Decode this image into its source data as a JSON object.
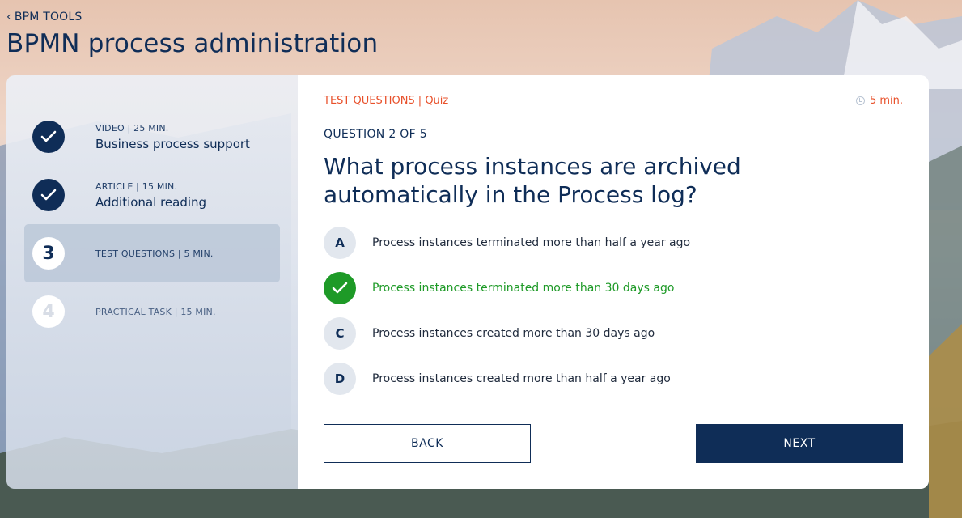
{
  "header": {
    "back_label": "BPM TOOLS",
    "title": "BPMN process administration"
  },
  "sidebar": {
    "steps": [
      {
        "state": "done",
        "meta": "VIDEO | 25 MIN.",
        "title": "Business process support"
      },
      {
        "state": "done",
        "meta": "ARTICLE | 15 MIN.",
        "title": "Additional reading"
      },
      {
        "state": "current",
        "number": "3",
        "meta": "TEST QUESTIONS | 5 MIN."
      },
      {
        "state": "todo",
        "number": "4",
        "meta": "PRACTICAL TASK | 15 MIN."
      }
    ]
  },
  "quiz": {
    "crumb": "TEST QUESTIONS | Quiz",
    "duration": "5 min.",
    "counter": "QUESTION 2 OF 5",
    "question": "What process instances are archived automatically in the Process log?",
    "answers": [
      {
        "letter": "A",
        "text": "Process instances terminated more than half a year ago",
        "correct": false
      },
      {
        "letter": "B",
        "text": "Process instances terminated more than 30 days ago",
        "correct": true
      },
      {
        "letter": "C",
        "text": "Process instances created more than 30 days ago",
        "correct": false
      },
      {
        "letter": "D",
        "text": "Process instances created more than half a year ago",
        "correct": false
      }
    ]
  },
  "buttons": {
    "back_label": "BACK",
    "next_label": "NEXT"
  },
  "colors": {
    "primary": "#0f2d57",
    "accent": "#e8502a",
    "correct": "#1e9a27"
  },
  "icons": {
    "back": "chevron-left-icon",
    "done": "check-icon",
    "timer": "clock-icon",
    "correct": "check-icon"
  }
}
